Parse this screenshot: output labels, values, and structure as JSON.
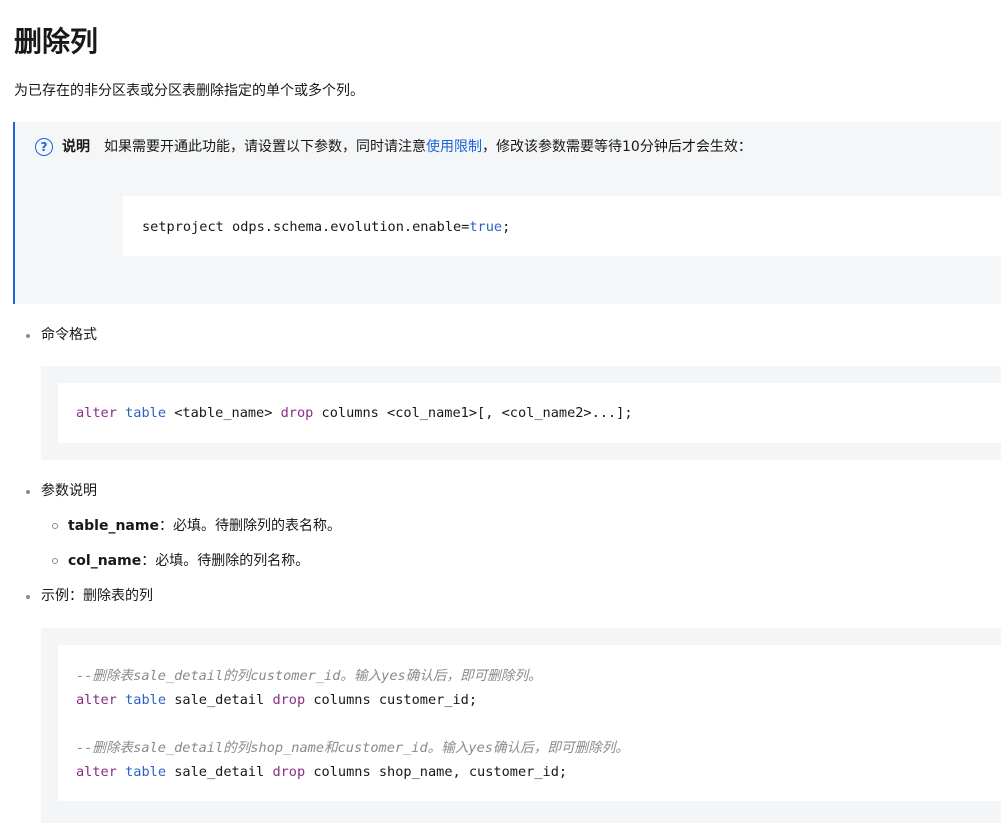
{
  "page": {
    "title": "删除列",
    "intro": "为已存在的非分区表或分区表删除指定的单个或多个列。"
  },
  "note": {
    "icon": "question-circle-icon",
    "label": "说明",
    "text_before": "如果需要开通此功能，请设置以下参数，同时请注意",
    "link": "使用限制",
    "text_after": "，修改该参数需要等待10分钟后才会生效：",
    "code_plain": "setproject odps.schema.evolution.enable=",
    "code_value": "true",
    "code_end": ";"
  },
  "format": {
    "label": "命令格式",
    "code": {
      "k1": "alter",
      "k2": "table",
      "p1": " <table_name> ",
      "k3": "drop",
      "p2": " columns <col_name1>[, <col_name2>...];"
    }
  },
  "params": {
    "label": "参数说明",
    "items": [
      {
        "name": "table_name",
        "desc": "：必填。待删除列的表名称。"
      },
      {
        "name": "col_name",
        "desc": "：必填。待删除的列名称。"
      }
    ]
  },
  "example": {
    "label": "示例：删除表的列",
    "comment1": "--删除表sale_detail的列customer_id。输入yes确认后，即可删除列。",
    "line1": {
      "k1": "alter",
      "k2": "table",
      "p1": " sale_detail ",
      "k3": "drop",
      "p2": " columns customer_id;"
    },
    "comment2": "--删除表sale_detail的列shop_name和customer_id。输入yes确认后，即可删除列。",
    "line2": {
      "k1": "alter",
      "k2": "table",
      "p1": " sale_detail ",
      "k3": "drop",
      "p2": " columns shop_name, customer_id;"
    }
  },
  "colors": {
    "accent": "#1b64d8",
    "keyword": "#8a2d87",
    "keyword2": "#2c62c5",
    "comment": "#8a8a8a"
  }
}
